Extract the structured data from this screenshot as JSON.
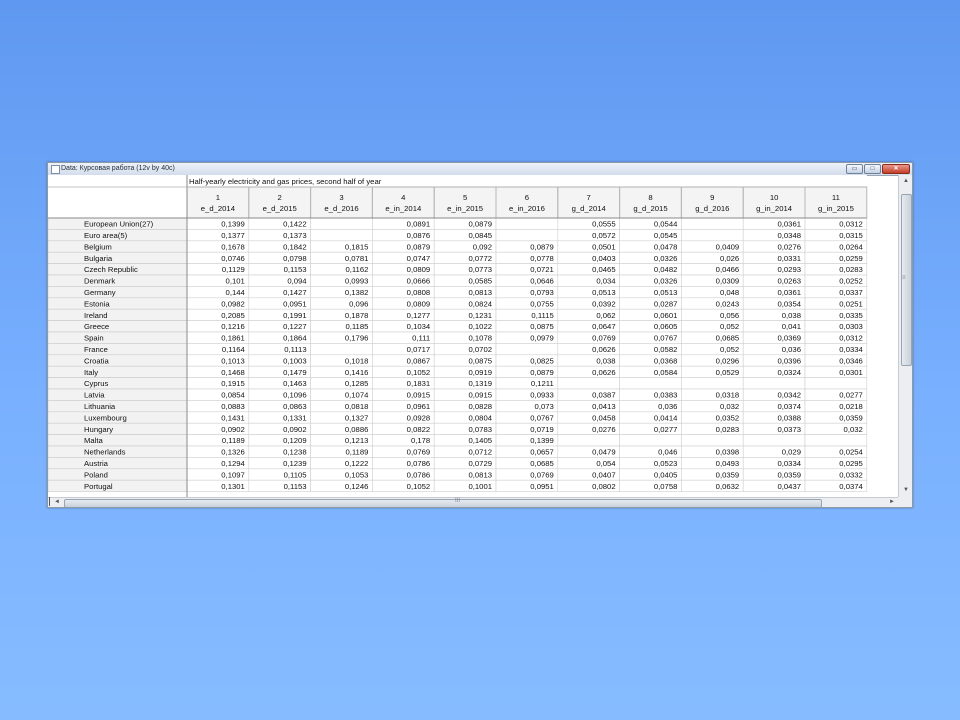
{
  "window": {
    "title": "Data: Курсовая работа (12v by 40c)",
    "buttons": {
      "minimize": "▭",
      "maximize": "□",
      "close": "✕"
    }
  },
  "table": {
    "caption": "Half-yearly electricity and gas prices, second half of year",
    "columns": [
      {
        "num": "1",
        "name": "e_d_2014"
      },
      {
        "num": "2",
        "name": "e_d_2015"
      },
      {
        "num": "3",
        "name": "e_d_2016"
      },
      {
        "num": "4",
        "name": "e_in_2014"
      },
      {
        "num": "5",
        "name": "e_in_2015"
      },
      {
        "num": "6",
        "name": "e_in_2016"
      },
      {
        "num": "7",
        "name": "g_d_2014"
      },
      {
        "num": "8",
        "name": "g_d_2015"
      },
      {
        "num": "9",
        "name": "g_d_2016"
      },
      {
        "num": "10",
        "name": "g_in_2014"
      },
      {
        "num": "11",
        "name": "g_in_2015"
      }
    ],
    "rows": [
      {
        "label": "European Union(27)",
        "values": [
          "0,1399",
          "0,1422",
          "",
          "0,0891",
          "0,0879",
          "",
          "0,0555",
          "0,0544",
          "",
          "0,0361",
          "0,0312"
        ]
      },
      {
        "label": "Euro area(5)",
        "values": [
          "0,1377",
          "0,1373",
          "",
          "0,0876",
          "0,0845",
          "",
          "0,0572",
          "0,0545",
          "",
          "0,0348",
          "0,0315"
        ]
      },
      {
        "label": "Belgium",
        "values": [
          "0,1678",
          "0,1842",
          "0,1815",
          "0,0879",
          "0,092",
          "0,0879",
          "0,0501",
          "0,0478",
          "0,0409",
          "0,0276",
          "0,0264"
        ]
      },
      {
        "label": "Bulgaria",
        "values": [
          "0,0746",
          "0,0798",
          "0,0781",
          "0,0747",
          "0,0772",
          "0,0778",
          "0,0403",
          "0,0326",
          "0,026",
          "0,0331",
          "0,0259"
        ]
      },
      {
        "label": "Czech Republic",
        "values": [
          "0,1129",
          "0,1153",
          "0,1162",
          "0,0809",
          "0,0773",
          "0,0721",
          "0,0465",
          "0,0482",
          "0,0466",
          "0,0293",
          "0,0283"
        ]
      },
      {
        "label": "Denmark",
        "values": [
          "0,101",
          "0,094",
          "0,0993",
          "0,0666",
          "0,0585",
          "0,0646",
          "0,034",
          "0,0326",
          "0,0309",
          "0,0263",
          "0,0252"
        ]
      },
      {
        "label": "Germany",
        "values": [
          "0,144",
          "0,1427",
          "0,1382",
          "0,0808",
          "0,0813",
          "0,0793",
          "0,0513",
          "0,0513",
          "0,048",
          "0,0361",
          "0,0337"
        ]
      },
      {
        "label": "Estonia",
        "values": [
          "0,0982",
          "0,0951",
          "0,096",
          "0,0809",
          "0,0824",
          "0,0755",
          "0,0392",
          "0,0287",
          "0,0243",
          "0,0354",
          "0,0251"
        ]
      },
      {
        "label": "Ireland",
        "values": [
          "0,2085",
          "0,1991",
          "0,1878",
          "0,1277",
          "0,1231",
          "0,1115",
          "0,062",
          "0,0601",
          "0,056",
          "0,038",
          "0,0335"
        ]
      },
      {
        "label": "Greece",
        "values": [
          "0,1216",
          "0,1227",
          "0,1185",
          "0,1034",
          "0,1022",
          "0,0875",
          "0,0647",
          "0,0605",
          "0,052",
          "0,041",
          "0,0303"
        ]
      },
      {
        "label": "Spain",
        "values": [
          "0,1861",
          "0,1864",
          "0,1796",
          "0,111",
          "0,1078",
          "0,0979",
          "0,0769",
          "0,0767",
          "0,0685",
          "0,0369",
          "0,0312"
        ]
      },
      {
        "label": "France",
        "values": [
          "0,1164",
          "0,1113",
          "",
          "0,0717",
          "0,0702",
          "",
          "0,0626",
          "0,0582",
          "0,052",
          "0,036",
          "0,0334"
        ]
      },
      {
        "label": "Croatia",
        "values": [
          "0,1013",
          "0,1003",
          "0,1018",
          "0,0867",
          "0,0875",
          "0,0825",
          "0,038",
          "0,0368",
          "0,0296",
          "0,0396",
          "0,0346"
        ]
      },
      {
        "label": "Italy",
        "values": [
          "0,1468",
          "0,1479",
          "0,1416",
          "0,1052",
          "0,0919",
          "0,0879",
          "0,0626",
          "0,0584",
          "0,0529",
          "0,0324",
          "0,0301"
        ]
      },
      {
        "label": "Cyprus",
        "values": [
          "0,1915",
          "0,1463",
          "0,1285",
          "0,1831",
          "0,1319",
          "0,1211",
          "",
          "",
          "",
          "",
          ""
        ]
      },
      {
        "label": "Latvia",
        "values": [
          "0,0854",
          "0,1096",
          "0,1074",
          "0,0915",
          "0,0915",
          "0,0933",
          "0,0387",
          "0,0383",
          "0,0318",
          "0,0342",
          "0,0277"
        ]
      },
      {
        "label": "Lithuania",
        "values": [
          "0,0883",
          "0,0863",
          "0,0818",
          "0,0961",
          "0,0828",
          "0,073",
          "0,0413",
          "0,036",
          "0,032",
          "0,0374",
          "0,0218"
        ]
      },
      {
        "label": "Luxembourg",
        "values": [
          "0,1431",
          "0,1331",
          "0,1327",
          "0,0928",
          "0,0804",
          "0,0767",
          "0,0458",
          "0,0414",
          "0,0352",
          "0,0388",
          "0,0359"
        ]
      },
      {
        "label": "Hungary",
        "values": [
          "0,0902",
          "0,0902",
          "0,0886",
          "0,0822",
          "0,0783",
          "0,0719",
          "0,0276",
          "0,0277",
          "0,0283",
          "0,0373",
          "0,032"
        ]
      },
      {
        "label": "Malta",
        "values": [
          "0,1189",
          "0,1209",
          "0,1213",
          "0,178",
          "0,1405",
          "0,1399",
          "",
          "",
          "",
          "",
          ""
        ]
      },
      {
        "label": "Netherlands",
        "values": [
          "0,1326",
          "0,1238",
          "0,1189",
          "0,0769",
          "0,0712",
          "0,0657",
          "0,0479",
          "0,046",
          "0,0398",
          "0,029",
          "0,0254"
        ]
      },
      {
        "label": "Austria",
        "values": [
          "0,1294",
          "0,1239",
          "0,1222",
          "0,0786",
          "0,0729",
          "0,0685",
          "0,054",
          "0,0523",
          "0,0493",
          "0,0334",
          "0,0295"
        ]
      },
      {
        "label": "Poland",
        "values": [
          "0,1097",
          "0,1105",
          "0,1053",
          "0,0786",
          "0,0813",
          "0,0769",
          "0,0407",
          "0,0405",
          "0,0359",
          "0,0359",
          "0,0332"
        ]
      },
      {
        "label": "Portugal",
        "values": [
          "0,1301",
          "0,1153",
          "0,1246",
          "0,1052",
          "0,1001",
          "0,0951",
          "0,0802",
          "0,0758",
          "0,0632",
          "0,0437",
          "0,0374"
        ]
      }
    ]
  },
  "scrollbars": {
    "up": "▲",
    "down": "▼",
    "left": "◄",
    "right": "►",
    "grip_v": "≡",
    "grip_h": "III"
  }
}
